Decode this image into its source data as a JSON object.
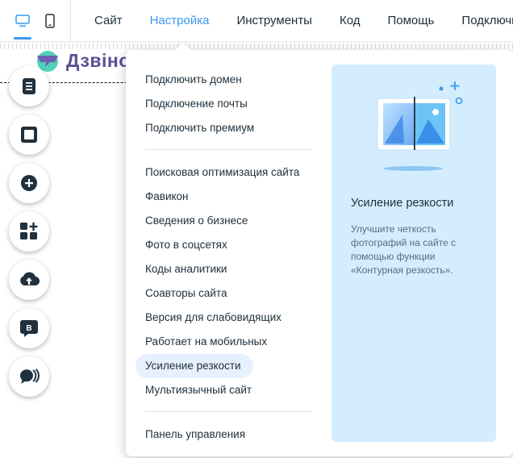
{
  "topbar": {
    "device_buttons": [
      {
        "icon": "desktop-icon",
        "active": true
      },
      {
        "icon": "mobile-icon",
        "active": false
      }
    ],
    "menu": [
      {
        "label": "Сайт",
        "active": false
      },
      {
        "label": "Настройка",
        "active": true
      },
      {
        "label": "Инструменты",
        "active": false
      },
      {
        "label": "Код",
        "active": false
      },
      {
        "label": "Помощь",
        "active": false
      },
      {
        "label": "Подключит",
        "active": false
      }
    ]
  },
  "site": {
    "logo_text": "Дзвіно"
  },
  "tools": [
    {
      "icon": "pages-icon"
    },
    {
      "icon": "background-icon"
    },
    {
      "icon": "add-icon"
    },
    {
      "icon": "apps-icon"
    },
    {
      "icon": "upload-icon"
    },
    {
      "icon": "blog-icon",
      "letter": "B"
    },
    {
      "icon": "chat-icon"
    }
  ],
  "dropdown": {
    "group1": [
      "Подключить домен",
      "Подключение почты",
      "Подключить премиум"
    ],
    "group2": [
      "Поисковая оптимизация сайта",
      "Фавикон",
      "Сведения о бизнесе",
      "Фото в соцсетях",
      "Коды аналитики",
      "Соавторы сайта",
      "Версия для слабовидящих",
      "Работает на мобильных",
      "Усиление резкости",
      "Мультиязычный сайт"
    ],
    "group3": [
      "Панель управления"
    ],
    "highlighted": "Усиление резкости"
  },
  "preview": {
    "title": "Усиление резкости",
    "description": "Улучшите четкость фотографий на сайте с помощью функции «Контурная резкость».",
    "illustration_icon": "sharpen-image-icon"
  },
  "colors": {
    "accent": "#3899ec",
    "highlight_bg": "#e7f0ff",
    "preview_bg": "#d3edff",
    "logo": "#5c4f95",
    "orange": "#f7a04b"
  }
}
